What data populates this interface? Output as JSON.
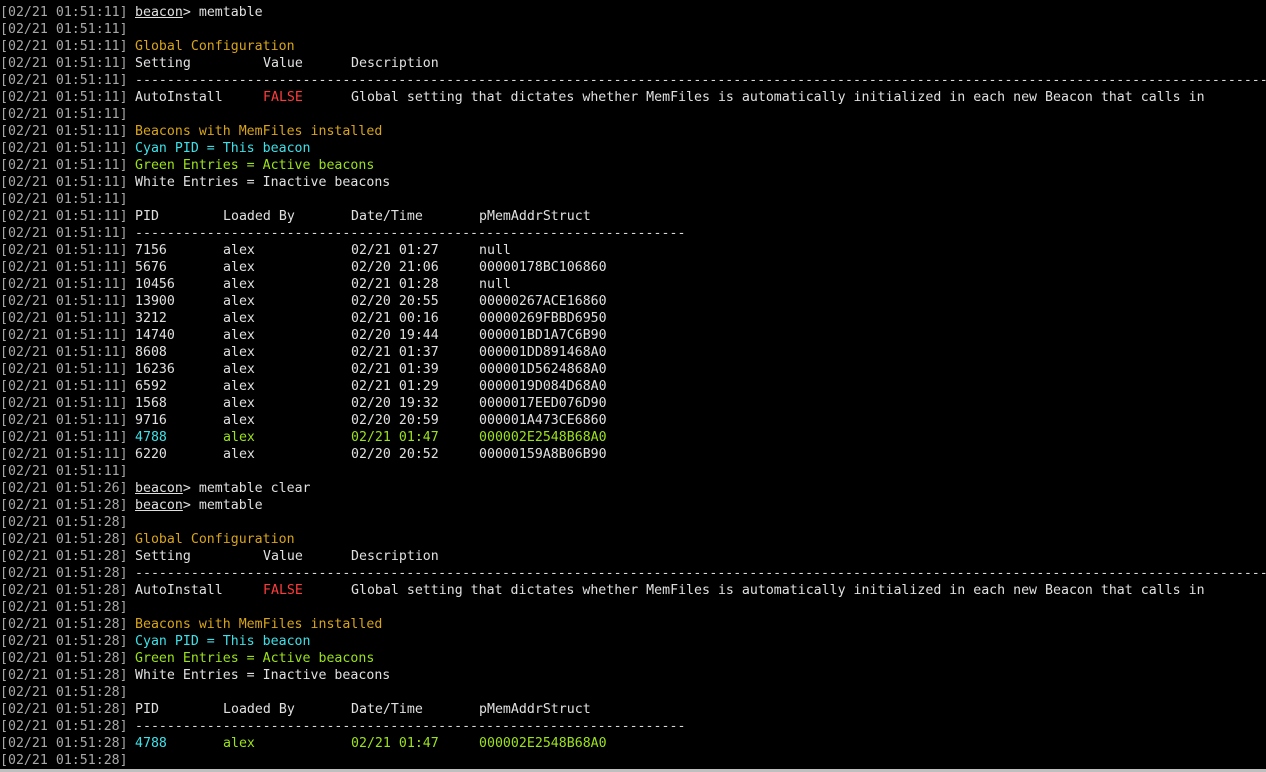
{
  "prompt": {
    "name": "beacon",
    "symbol": ">"
  },
  "colors": {
    "background": "#000000",
    "timestamp": "#a8a8a8",
    "text": "#d8d8d8",
    "heading": "#d7a41a",
    "cyan": "#3ee0e8",
    "green": "#9be21a",
    "red": "#ff3b3b"
  },
  "text": {
    "cmd_memtable": "memtable",
    "cmd_memtable_clear": "memtable clear",
    "global_config": "Global Configuration",
    "col_setting": "Setting",
    "col_value": "Value",
    "col_description": "Description",
    "dashes_long": "----------------------------------------------------------------------------------------------------------------------------------------------",
    "dashes_short": "---------------------------------------------------------------------",
    "setting_name": "AutoInstall",
    "setting_value": "FALSE",
    "setting_description": "Global setting that dictates whether MemFiles is automatically initialized in each new Beacon that calls in",
    "beacons_heading": "Beacons with MemFiles installed",
    "legend_cyan": "Cyan PID = This beacon",
    "legend_green": "Green Entries = Active beacons",
    "legend_white": "White Entries = Inactive beacons",
    "col_pid": "PID",
    "col_loaded_by": "Loaded By",
    "col_datetime": "Date/Time",
    "col_pmem": "pMemAddrStruct"
  },
  "lines": [
    {
      "ts": "[02/21 01:51:11]",
      "kind": "prompt",
      "cmd": "cmd_memtable"
    },
    {
      "ts": "[02/21 01:51:11]",
      "kind": "blank"
    },
    {
      "ts": "[02/21 01:51:11]",
      "kind": "heading",
      "key": "global_config"
    },
    {
      "ts": "[02/21 01:51:11]",
      "kind": "settings_header"
    },
    {
      "ts": "[02/21 01:51:11]",
      "kind": "dashes",
      "key": "dashes_long"
    },
    {
      "ts": "[02/21 01:51:11]",
      "kind": "setting_row"
    },
    {
      "ts": "[02/21 01:51:11]",
      "kind": "blank"
    },
    {
      "ts": "[02/21 01:51:11]",
      "kind": "heading",
      "key": "beacons_heading"
    },
    {
      "ts": "[02/21 01:51:11]",
      "kind": "legend",
      "key": "legend_cyan",
      "color": "cyan"
    },
    {
      "ts": "[02/21 01:51:11]",
      "kind": "legend",
      "key": "legend_green",
      "color": "green"
    },
    {
      "ts": "[02/21 01:51:11]",
      "kind": "legend",
      "key": "legend_white",
      "color": "white"
    },
    {
      "ts": "[02/21 01:51:11]",
      "kind": "blank"
    },
    {
      "ts": "[02/21 01:51:11]",
      "kind": "beacons_header"
    },
    {
      "ts": "[02/21 01:51:11]",
      "kind": "dashes",
      "key": "dashes_short"
    },
    {
      "ts": "[02/21 01:51:11]",
      "kind": "row",
      "pid": "7156",
      "user": "alex",
      "datetime": "02/21 01:27",
      "addr": "null",
      "status": "inactive"
    },
    {
      "ts": "[02/21 01:51:11]",
      "kind": "row",
      "pid": "5676",
      "user": "alex",
      "datetime": "02/20 21:06",
      "addr": "00000178BC106860",
      "status": "inactive"
    },
    {
      "ts": "[02/21 01:51:11]",
      "kind": "row",
      "pid": "10456",
      "user": "alex",
      "datetime": "02/21 01:28",
      "addr": "null",
      "status": "inactive"
    },
    {
      "ts": "[02/21 01:51:11]",
      "kind": "row",
      "pid": "13900",
      "user": "alex",
      "datetime": "02/20 20:55",
      "addr": "00000267ACE16860",
      "status": "inactive"
    },
    {
      "ts": "[02/21 01:51:11]",
      "kind": "row",
      "pid": "3212",
      "user": "alex",
      "datetime": "02/21 00:16",
      "addr": "00000269FBBD6950",
      "status": "inactive"
    },
    {
      "ts": "[02/21 01:51:11]",
      "kind": "row",
      "pid": "14740",
      "user": "alex",
      "datetime": "02/20 19:44",
      "addr": "000001BD1A7C6B90",
      "status": "inactive"
    },
    {
      "ts": "[02/21 01:51:11]",
      "kind": "row",
      "pid": "8608",
      "user": "alex",
      "datetime": "02/21 01:37",
      "addr": "000001DD891468A0",
      "status": "inactive"
    },
    {
      "ts": "[02/21 01:51:11]",
      "kind": "row",
      "pid": "16236",
      "user": "alex",
      "datetime": "02/21 01:39",
      "addr": "000001D5624868A0",
      "status": "inactive"
    },
    {
      "ts": "[02/21 01:51:11]",
      "kind": "row",
      "pid": "6592",
      "user": "alex",
      "datetime": "02/21 01:29",
      "addr": "0000019D084D68A0",
      "status": "inactive"
    },
    {
      "ts": "[02/21 01:51:11]",
      "kind": "row",
      "pid": "1568",
      "user": "alex",
      "datetime": "02/20 19:32",
      "addr": "0000017EED076D90",
      "status": "inactive"
    },
    {
      "ts": "[02/21 01:51:11]",
      "kind": "row",
      "pid": "9716",
      "user": "alex",
      "datetime": "02/20 20:59",
      "addr": "000001A473CE6860",
      "status": "inactive"
    },
    {
      "ts": "[02/21 01:51:11]",
      "kind": "row",
      "pid": "4788",
      "user": "alex",
      "datetime": "02/21 01:47",
      "addr": "000002E2548B68A0",
      "status": "current"
    },
    {
      "ts": "[02/21 01:51:11]",
      "kind": "row",
      "pid": "6220",
      "user": "alex",
      "datetime": "02/20 20:52",
      "addr": "00000159A8B06B90",
      "status": "inactive"
    },
    {
      "ts": "[02/21 01:51:11]",
      "kind": "blank"
    },
    {
      "ts": "[02/21 01:51:26]",
      "kind": "prompt",
      "cmd": "cmd_memtable_clear"
    },
    {
      "ts": "[02/21 01:51:28]",
      "kind": "prompt",
      "cmd": "cmd_memtable"
    },
    {
      "ts": "[02/21 01:51:28]",
      "kind": "blank"
    },
    {
      "ts": "[02/21 01:51:28]",
      "kind": "heading",
      "key": "global_config"
    },
    {
      "ts": "[02/21 01:51:28]",
      "kind": "settings_header"
    },
    {
      "ts": "[02/21 01:51:28]",
      "kind": "dashes",
      "key": "dashes_long"
    },
    {
      "ts": "[02/21 01:51:28]",
      "kind": "setting_row"
    },
    {
      "ts": "[02/21 01:51:28]",
      "kind": "blank"
    },
    {
      "ts": "[02/21 01:51:28]",
      "kind": "heading",
      "key": "beacons_heading"
    },
    {
      "ts": "[02/21 01:51:28]",
      "kind": "legend",
      "key": "legend_cyan",
      "color": "cyan"
    },
    {
      "ts": "[02/21 01:51:28]",
      "kind": "legend",
      "key": "legend_green",
      "color": "green"
    },
    {
      "ts": "[02/21 01:51:28]",
      "kind": "legend",
      "key": "legend_white",
      "color": "white"
    },
    {
      "ts": "[02/21 01:51:28]",
      "kind": "blank"
    },
    {
      "ts": "[02/21 01:51:28]",
      "kind": "beacons_header"
    },
    {
      "ts": "[02/21 01:51:28]",
      "kind": "dashes",
      "key": "dashes_short"
    },
    {
      "ts": "[02/21 01:51:28]",
      "kind": "row",
      "pid": "4788",
      "user": "alex",
      "datetime": "02/21 01:47",
      "addr": "000002E2548B68A0",
      "status": "current"
    },
    {
      "ts": "[02/21 01:51:28]",
      "kind": "blank"
    }
  ]
}
